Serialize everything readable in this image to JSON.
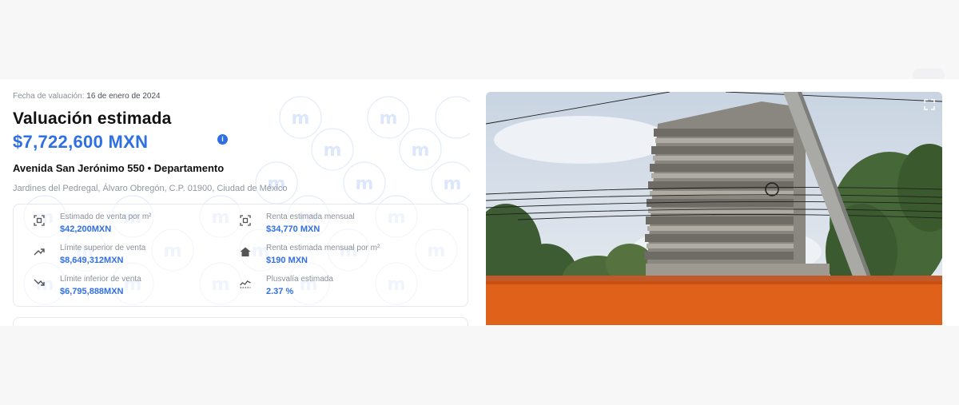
{
  "valuation": {
    "date_label": "Fecha de valuación:",
    "date_value": "16 de enero de 2024",
    "title": "Valuación estimada",
    "price": "$7,722,600 MXN",
    "info_icon": "info-icon"
  },
  "property": {
    "address": "Avenida San Jerónimo 550 • Departamento",
    "locality": "Jardines del Pedregal, Álvaro Obregón, C.P. 01900, Ciudad de México"
  },
  "metrics": [
    {
      "icon": "area-icon",
      "label": "Estimado de venta por m²",
      "value": "$42,200MXN"
    },
    {
      "icon": "area-icon",
      "label": "Renta estimada mensual",
      "value": "$34,770 MXN"
    },
    {
      "icon": "trend-up-icon",
      "label": "Límite superior de venta",
      "value": "$8,649,312MXN"
    },
    {
      "icon": "home-icon",
      "label": "Renta estimada mensual por m²",
      "value": "$190 MXN"
    },
    {
      "icon": "trend-down-icon",
      "label": "Límite inferior de venta",
      "value": "$6,795,888MXN"
    },
    {
      "icon": "chart-line-icon",
      "label": "Plusvalía estimada",
      "value": "2.37 %"
    }
  ],
  "photo": {
    "expand_icon": "expand-icon"
  },
  "colors": {
    "accent": "#2f6fe4",
    "muted_text": "#8a8f99",
    "background": "#f7f7f8"
  }
}
